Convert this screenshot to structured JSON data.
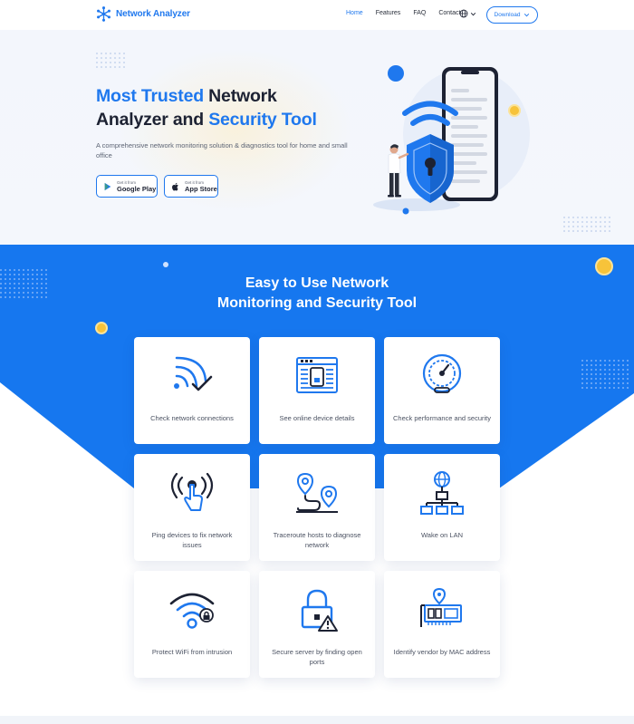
{
  "colors": {
    "primary": "#1f78ee",
    "dark": "#1d2233",
    "muted": "#5d6474",
    "gold": "#f7c33a"
  },
  "nav": {
    "brand": "Network Analyzer",
    "brand_icon": "snowflake-network-icon",
    "items": [
      {
        "label": "Home",
        "active": true
      },
      {
        "label": "Features",
        "active": false
      },
      {
        "label": "FAQ",
        "active": false
      },
      {
        "label": "Contact",
        "active": false
      }
    ],
    "language_icon": "globe-icon",
    "download_label": "Download"
  },
  "hero": {
    "title_blue_1": "Most Trusted",
    "title_dark_1": " Network",
    "title_dark_2": "Analyzer and ",
    "title_blue_2": "Security Tool",
    "subtitle": "A comprehensive network monitoring solution & diagnostics tool for home and small office",
    "google_play": {
      "small": "Get it from",
      "big": "Google Play",
      "icon": "google-play-icon"
    },
    "app_store": {
      "small": "Get it from",
      "big": "App Store",
      "icon": "apple-icon"
    }
  },
  "features": {
    "title_line1": "Easy to Use Network",
    "title_line2": "Monitoring and Security Tool",
    "cards": [
      {
        "label": "Check network connections",
        "icon": "wifi-check-icon"
      },
      {
        "label": "See online device details",
        "icon": "device-details-icon"
      },
      {
        "label": "Check performance and security",
        "icon": "speedometer-icon"
      },
      {
        "label": "Ping devices to fix network issues",
        "icon": "ping-tap-icon"
      },
      {
        "label": "Traceroute hosts to diagnose network",
        "icon": "route-pins-icon"
      },
      {
        "label": "Wake on LAN",
        "icon": "lan-tree-icon"
      },
      {
        "label": "Protect WiFi from intrusion",
        "icon": "wifi-lock-icon"
      },
      {
        "label": "Secure server by finding open ports",
        "icon": "padlock-warning-icon"
      },
      {
        "label": "Identify vendor by MAC address",
        "icon": "network-card-icon"
      }
    ]
  }
}
